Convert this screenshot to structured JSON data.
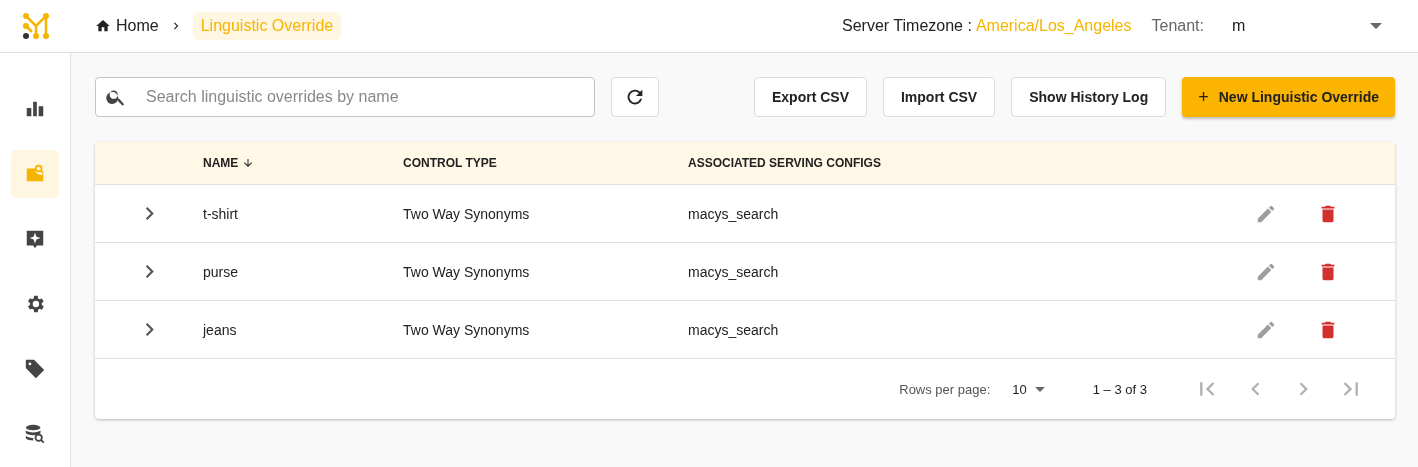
{
  "breadcrumb": {
    "home": "Home",
    "current": "Linguistic Override"
  },
  "header": {
    "timezone_label": "Server Timezone :",
    "timezone": "America/Los_Angeles",
    "tenant_label": "Tenant:",
    "tenant": "m"
  },
  "sidebar": {
    "items": [
      {
        "kind": "chart",
        "selected": false
      },
      {
        "kind": "search-doc",
        "selected": true
      },
      {
        "kind": "sparkle",
        "selected": false
      },
      {
        "kind": "gear",
        "selected": false
      },
      {
        "kind": "tag",
        "selected": false
      },
      {
        "kind": "database",
        "selected": false
      }
    ]
  },
  "toolbar": {
    "search_placeholder": "Search linguistic overrides by name",
    "buttons": [
      "Export CSV",
      "Import CSV",
      "Show History Log"
    ],
    "primary": "New Linguistic Override",
    "primary_icon": "+"
  },
  "table": {
    "columns": [
      "NAME",
      "CONTROL TYPE",
      "ASSOCIATED SERVING CONFIGS"
    ],
    "rows": [
      {
        "expanded": false,
        "cells": [
          "t-shirt",
          "Two Way Synonyms",
          "macys_search"
        ]
      },
      {
        "expanded": false,
        "cells": [
          "purse",
          "Two Way Synonyms",
          "macys_search"
        ]
      },
      {
        "expanded": false,
        "cells": [
          "jeans",
          "Two Way Synonyms",
          "macys_search"
        ]
      }
    ]
  },
  "pagination": {
    "rows_label": "Rows per page:",
    "rows_value": "10",
    "range": "1 – 3 of 3",
    "first_disabled": true,
    "prev_disabled": true,
    "next_disabled": true,
    "last_disabled": true
  }
}
